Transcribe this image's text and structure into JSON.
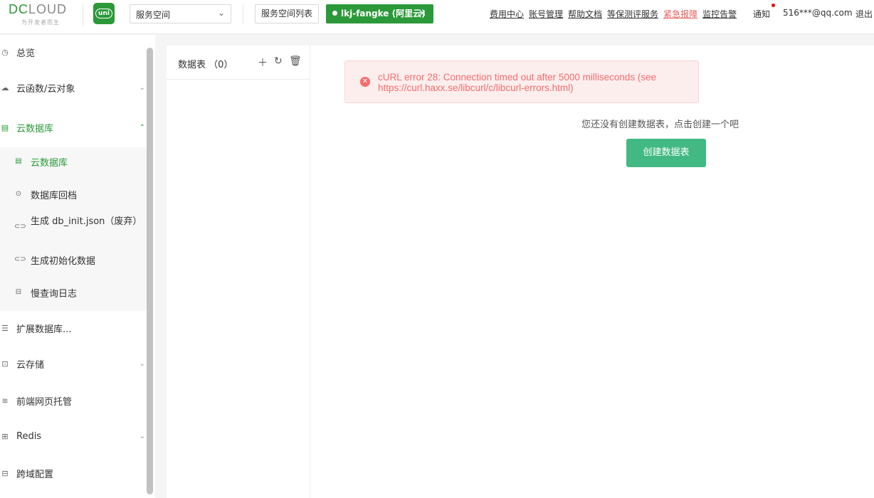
{
  "header": {
    "logo_text": "DCLOUD",
    "logo_subtitle": "为开发者而生",
    "uni_logo_text": "uni",
    "space_select": "服务空间",
    "space_list_button": "服务空间列表",
    "current_space": "lkj-fangke (阿里云)",
    "links": [
      "费用中心",
      "账号管理",
      "帮助文档",
      "等保测评服务",
      "紧急报障",
      "监控告警"
    ],
    "notify": "通知",
    "user_email": "516***@qq.com",
    "logout": "退出",
    "colors": {
      "brand": "#2b9939",
      "urgent": "#e65c5c",
      "notify_dot": "#ee0000"
    }
  },
  "sidebar": {
    "items": [
      {
        "label": "总览",
        "icon": "clock-icon"
      },
      {
        "label": "云函数/云对象",
        "icon": "cloud-icon"
      },
      {
        "label": "云数据库",
        "icon": "database-list-icon"
      },
      {
        "label": "扩展数据库...",
        "icon": "stack-database-icon"
      },
      {
        "label": "云存储",
        "icon": "storage-icon"
      },
      {
        "label": "前端网页托管",
        "icon": "web-hosting-icon"
      },
      {
        "label": "Redis",
        "icon": "redis-icon"
      },
      {
        "label": "跨域配置",
        "icon": "cors-icon"
      }
    ],
    "sub_items": [
      {
        "label": "云数据库",
        "icon": "database-list-icon"
      },
      {
        "label": "数据库回档",
        "icon": "rollback-icon"
      },
      {
        "label": "生成 db_init.json（废弃）",
        "icon": "link-icon"
      },
      {
        "label": "生成初始化数据",
        "icon": "link-icon"
      },
      {
        "label": "慢查询日志",
        "icon": "log-icon"
      }
    ]
  },
  "main": {
    "table_pane_title": "数据表 （0）",
    "error_message": "cURL error 28: Connection timed out after 5000 milliseconds (see https://curl.haxx.se/libcurl/c/libcurl-errors.html)",
    "empty_text": "您还没有创建数据表，点击创建一个吧",
    "create_button": "创建数据表",
    "colors": {
      "error": "#f56c6c",
      "primary_button": "#42b983"
    }
  }
}
